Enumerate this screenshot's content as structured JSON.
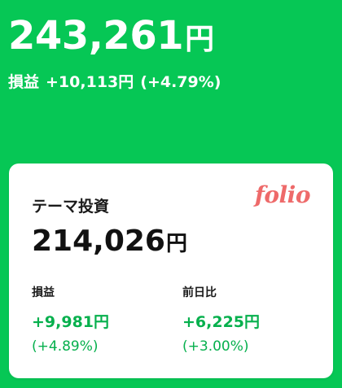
{
  "summary": {
    "total_value": "243,261",
    "currency_unit": "円",
    "pl_label": "損益",
    "pl_value": "+10,113円",
    "pl_pct": "(+4.79%)"
  },
  "card": {
    "title": "テーマ投資",
    "logo_text": "folio",
    "total_value": "214,026",
    "currency_unit": "円",
    "pl_label": "損益",
    "pl_value": "+9,981円",
    "pl_pct": "(+4.89%)",
    "daily_label": "前日比",
    "daily_value": "+6,225円",
    "daily_pct": "(+3.00%)"
  },
  "colors": {
    "background": "#06C755",
    "positive": "#06B04D",
    "logo": "#EE6A6A"
  }
}
